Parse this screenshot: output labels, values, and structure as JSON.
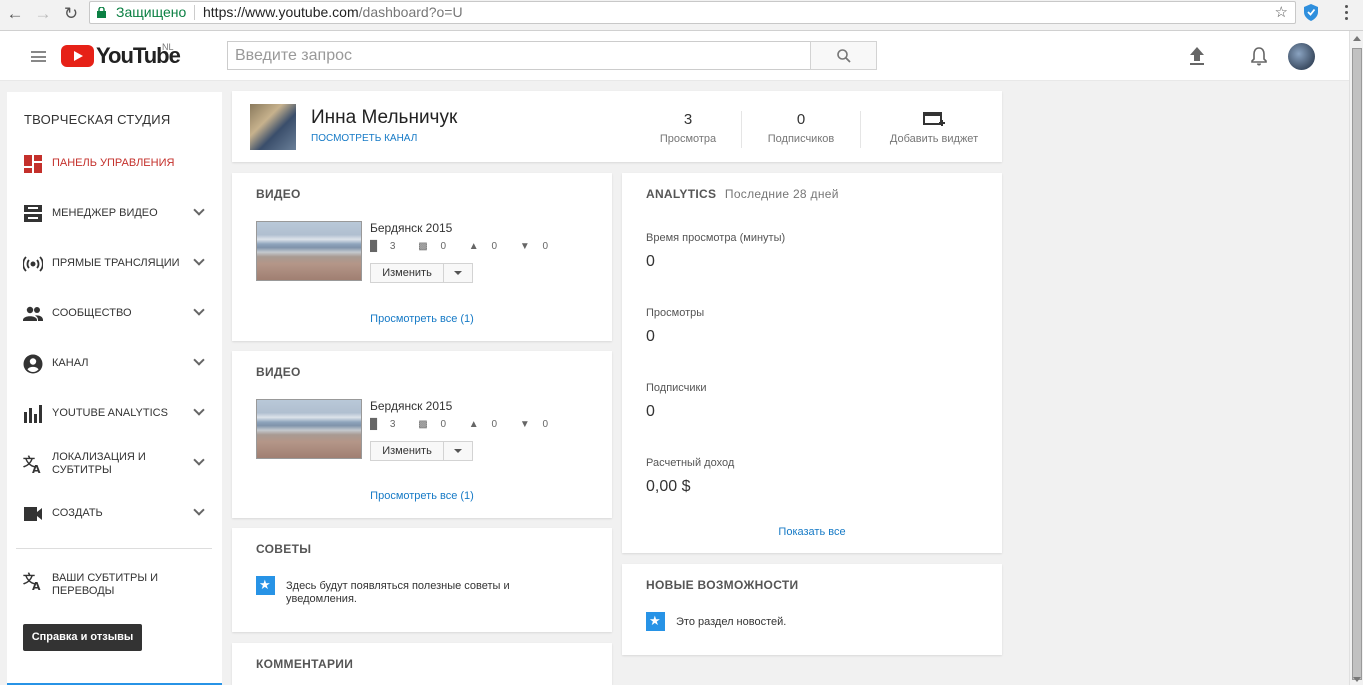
{
  "browser": {
    "secure_label": "Защищено",
    "url_host": "https://www.youtube.com",
    "url_path": "/dashboard?o=U"
  },
  "header": {
    "logo_text": "YouTube",
    "region": "NL",
    "search_placeholder": "Введите запрос"
  },
  "sidebar": {
    "studio_title": "ТВОРЧЕСКАЯ СТУДИЯ",
    "items": [
      {
        "label": "ПАНЕЛЬ УПРАВЛЕНИЯ"
      },
      {
        "label": "МЕНЕДЖЕР ВИДЕО"
      },
      {
        "label": "ПРЯМЫЕ ТРАНСЛЯЦИИ"
      },
      {
        "label": "СООБЩЕСТВО"
      },
      {
        "label": "КАНАЛ"
      },
      {
        "label": "YOUTUBE ANALYTICS"
      },
      {
        "label_line1": "ЛОКАЛИЗАЦИЯ И",
        "label_line2": "СУБТИТРЫ"
      },
      {
        "label": "СОЗДАТЬ"
      }
    ],
    "subtitles_line1": "ВАШИ СУБТИТРЫ И",
    "subtitles_line2": "ПЕРЕВОДЫ",
    "help_button": "Справка и отзывы",
    "accent_color": "#c4302b"
  },
  "channel": {
    "name": "Инна Мельничук",
    "view_channel": "ПОСМОТРЕТЬ КАНАЛ",
    "views_count": "3",
    "views_label": "Просмотра",
    "subs_count": "0",
    "subs_label": "Подписчиков",
    "add_widget": "Добавить виджет"
  },
  "video_cards": [
    {
      "title": "ВИДЕО",
      "video_title": "Бердянск 2015",
      "views": "3",
      "comments": "0",
      "likes": "0",
      "dislikes": "0",
      "edit_label": "Изменить",
      "see_all": "Просмотреть все (1)"
    },
    {
      "title": "ВИДЕО",
      "video_title": "Бердянск 2015",
      "views": "3",
      "comments": "0",
      "likes": "0",
      "dislikes": "0",
      "edit_label": "Изменить",
      "see_all": "Просмотреть все (1)"
    }
  ],
  "tips": {
    "title": "СОВЕТЫ",
    "text_line1": "Здесь будут появляться полезные советы и",
    "text_line2": "уведомления."
  },
  "comments": {
    "title": "КОММЕНТАРИИ"
  },
  "analytics": {
    "title": "ANALYTICS",
    "period": "Последние 28 дней",
    "metrics": [
      {
        "label": "Время просмотра (минуты)",
        "value": "0"
      },
      {
        "label": "Просмотры",
        "value": "0"
      },
      {
        "label": "Подписчики",
        "value": "0"
      },
      {
        "label": "Расчетный доход",
        "value": "0,00 $"
      }
    ],
    "show_all": "Показать все"
  },
  "news": {
    "title": "НОВЫЕ ВОЗМОЖНОСТИ",
    "text": "Это раздел новостей."
  }
}
